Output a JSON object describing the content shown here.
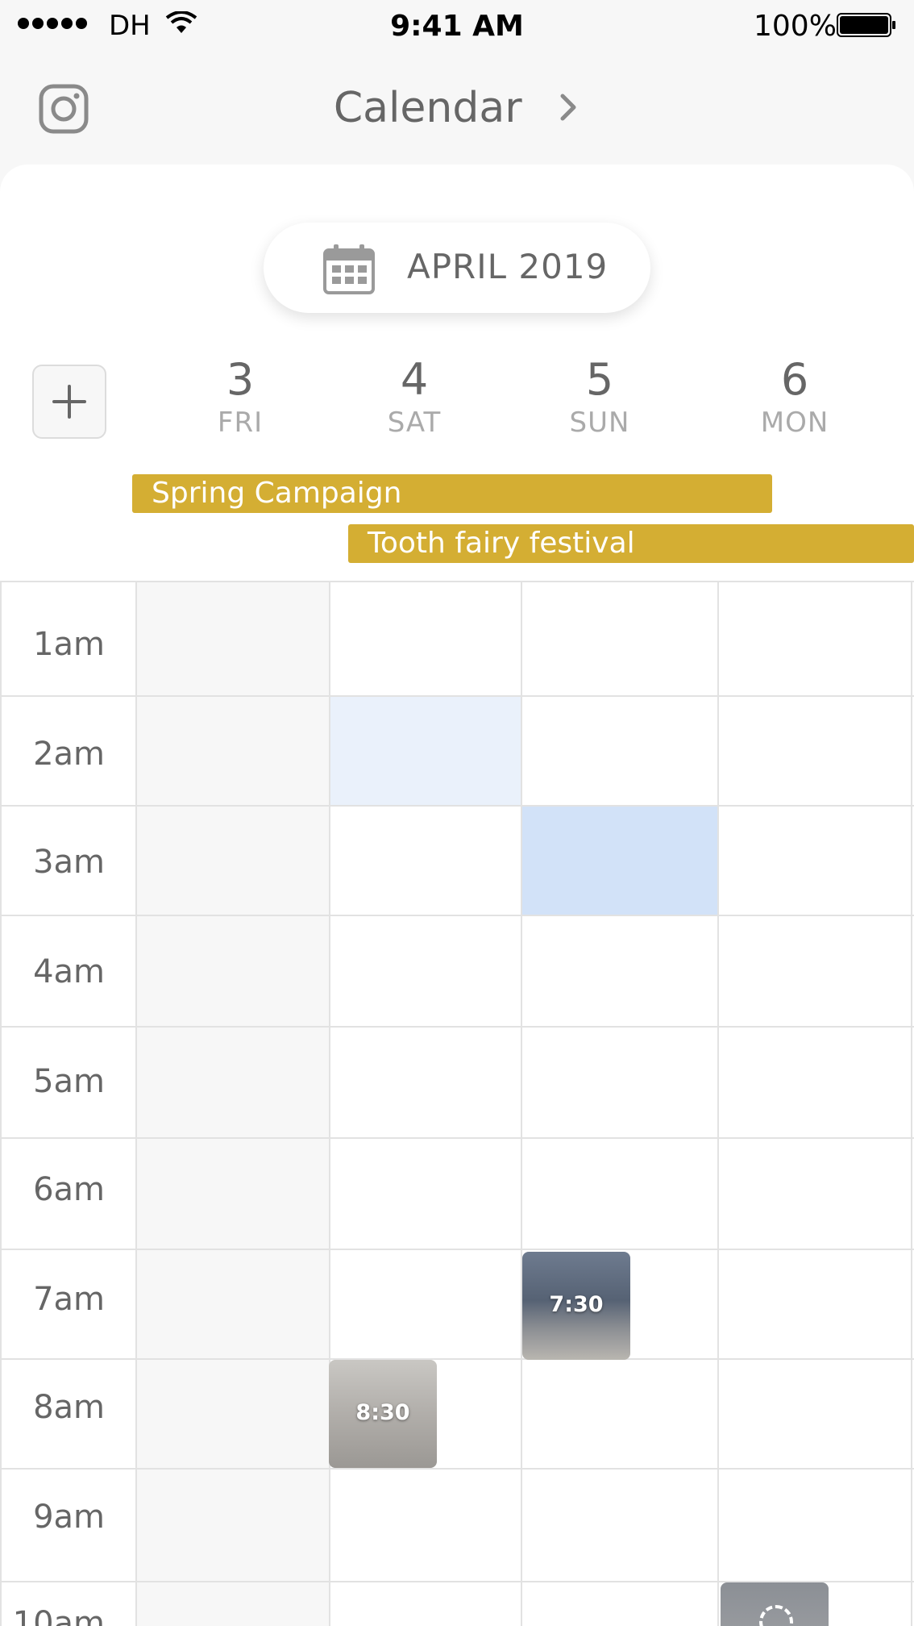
{
  "status_bar": {
    "carrier": "DH",
    "time": "9:41 AM",
    "battery": "100%"
  },
  "header": {
    "title": "Calendar"
  },
  "month_selector": {
    "label": "APRIL 2019"
  },
  "days": [
    {
      "num": "3",
      "dow": "FRI"
    },
    {
      "num": "4",
      "dow": "SAT"
    },
    {
      "num": "5",
      "dow": "SUN"
    },
    {
      "num": "6",
      "dow": "MON"
    }
  ],
  "events": [
    {
      "title": "Spring Campaign"
    },
    {
      "title": "Tooth fairy festival"
    }
  ],
  "hours": [
    "1am",
    "2am",
    "3am",
    "4am",
    "5am",
    "6am",
    "7am",
    "8am",
    "9am",
    "10am"
  ],
  "posts": [
    {
      "time": "7:30",
      "day": "SUN"
    },
    {
      "time": "8:30",
      "day": "SAT"
    }
  ],
  "colors": {
    "event": "#d4ae33",
    "selected_cell": "#d2e2f8",
    "hover_cell": "#eaf1fb",
    "gridline": "#e2e2e2"
  }
}
